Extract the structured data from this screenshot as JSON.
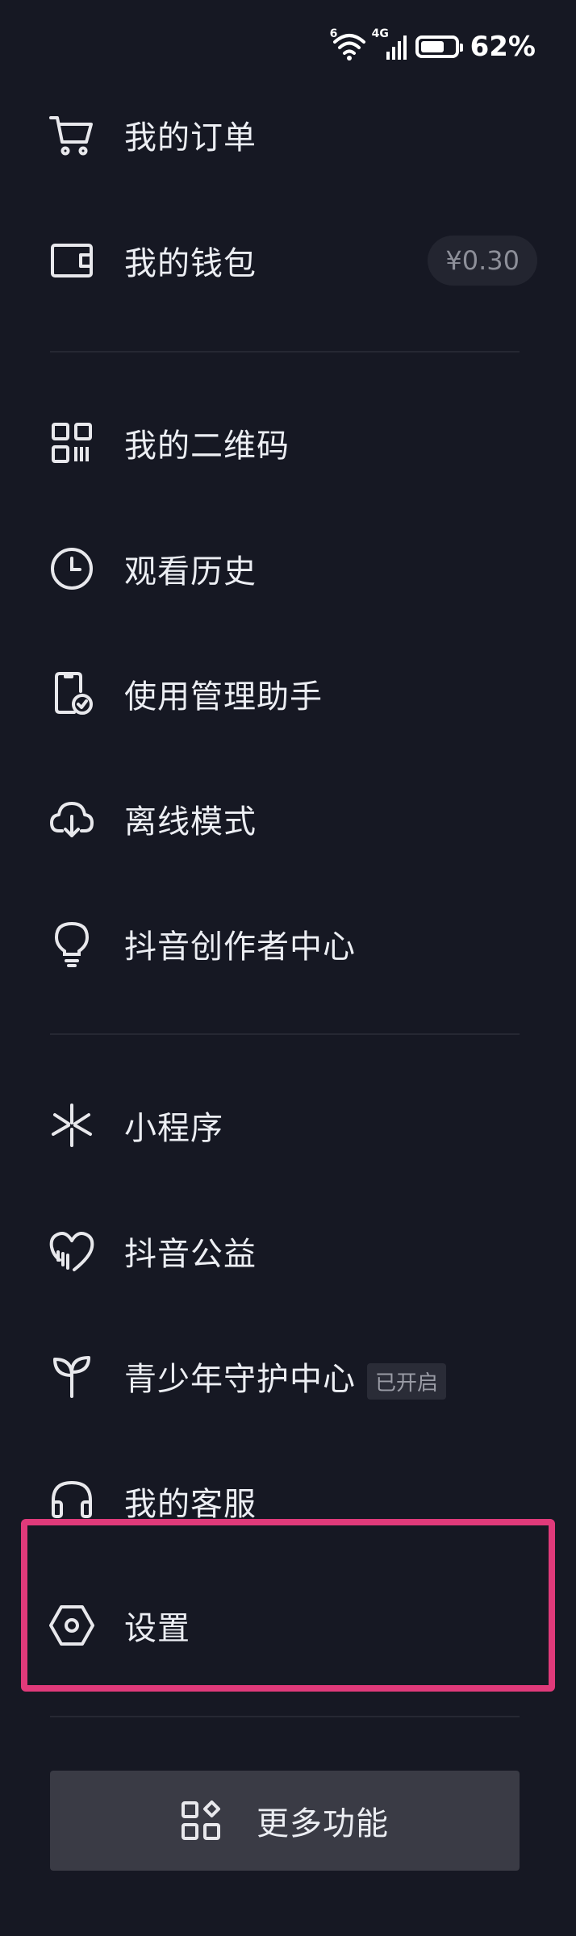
{
  "status_bar": {
    "battery_percent": "62%",
    "wifi_label": "6",
    "network_label": "4G",
    "battery_level": 0.62
  },
  "menu": {
    "orders": "我的订单",
    "wallet": "我的钱包",
    "wallet_balance": "¥0.30",
    "qrcode": "我的二维码",
    "history": "观看历史",
    "usage_assistant": "使用管理助手",
    "offline_mode": "离线模式",
    "creator_center": "抖音创作者中心",
    "mini_programs": "小程序",
    "charity": "抖音公益",
    "youth_protection": "青少年守护中心",
    "youth_protection_status": "已开启",
    "customer_service": "我的客服",
    "settings": "设置"
  },
  "more_button": {
    "label": "更多功能"
  },
  "icons": [
    "cart-icon",
    "wallet-icon",
    "qrcode-icon",
    "clock-icon",
    "phone-check-icon",
    "cloud-download-icon",
    "lightbulb-icon",
    "asterisk-icon",
    "heart-hands-icon",
    "sprout-icon",
    "headset-icon",
    "hexagon-settings-icon",
    "grid-shapes-icon"
  ],
  "colors": {
    "background": "#161823",
    "highlight": "#e03a7a",
    "button_bg": "#3a3b45"
  }
}
